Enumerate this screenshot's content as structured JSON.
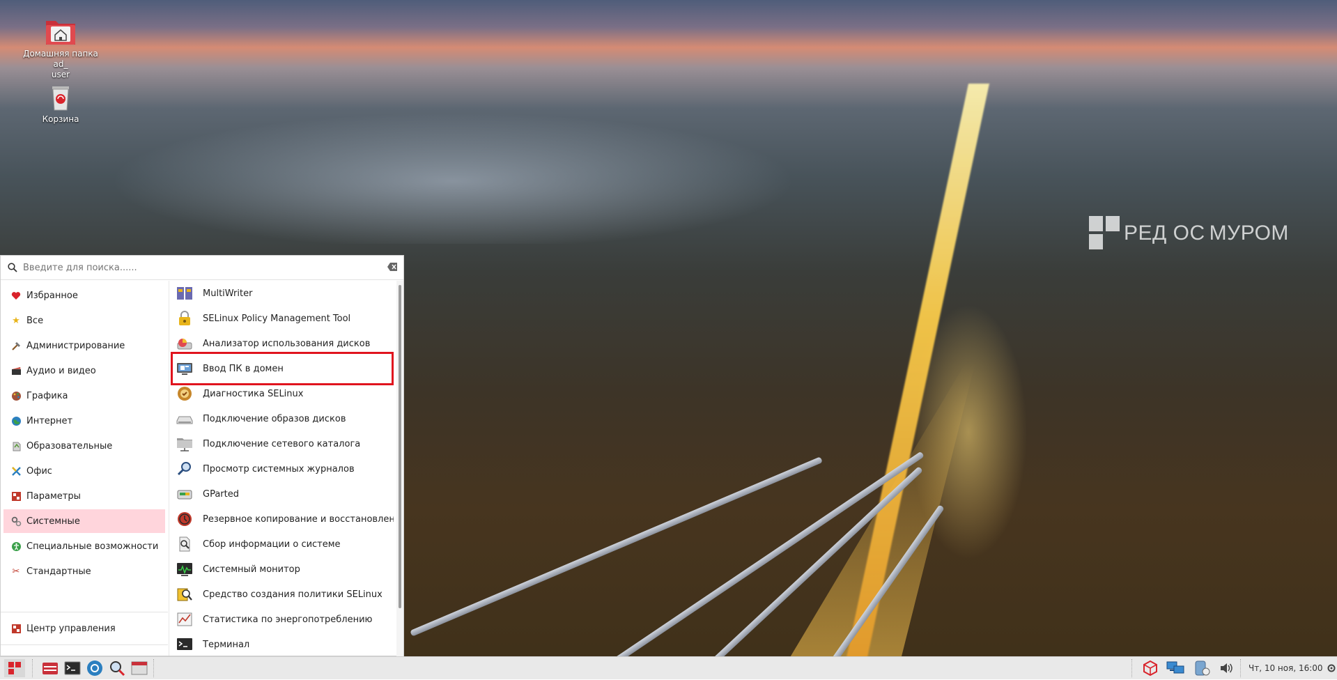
{
  "desktop": {
    "icons": [
      {
        "label": "Домашняя папка ad_\nuser",
        "icon": "home-folder-icon"
      },
      {
        "label": "Корзина",
        "icon": "trash-icon"
      }
    ],
    "watermark": {
      "brand": "РЕД ОС",
      "city": "МУРОМ"
    }
  },
  "menu": {
    "search": {
      "placeholder": "Введите для поиска......"
    },
    "categories": [
      {
        "label": "Избранное",
        "icon": "heart-icon",
        "color": "#d9222a"
      },
      {
        "label": "Все",
        "icon": "star-icon",
        "color": "#e8b41a"
      },
      {
        "label": "Администрирование",
        "icon": "tools-icon",
        "color": "#777777"
      },
      {
        "label": "Аудио и видео",
        "icon": "film-icon",
        "color": "#444444"
      },
      {
        "label": "Графика",
        "icon": "palette-icon",
        "color": "#b04a2a"
      },
      {
        "label": "Интернет",
        "icon": "globe-icon",
        "color": "#2b7fc0"
      },
      {
        "label": "Образовательные",
        "icon": "education-icon",
        "color": "#5a9a3a"
      },
      {
        "label": "Офис",
        "icon": "office-icon",
        "color": "#d89a1a"
      },
      {
        "label": "Параметры",
        "icon": "settings-icon",
        "color": "#c0392b"
      },
      {
        "label": "Системные",
        "icon": "system-icon",
        "color": "#777777",
        "active": true
      },
      {
        "label": "Специальные возможности",
        "icon": "accessibility-icon",
        "color": "#3aa04a"
      },
      {
        "label": "Стандартные",
        "icon": "scissors-icon",
        "color": "#c0392b"
      }
    ],
    "control_center": {
      "label": "Центр управления",
      "icon": "control-center-icon"
    },
    "bottom_buttons": [
      "logout-icon",
      "lock-icon",
      "power-icon"
    ],
    "apps": [
      {
        "label": "MultiWriter",
        "icon": "multiwriter-icon"
      },
      {
        "label": "SELinux Policy Management Tool",
        "icon": "selinux-lock-icon"
      },
      {
        "label": "Анализатор использования дисков",
        "icon": "disk-usage-icon"
      },
      {
        "label": "Ввод ПК в домен",
        "icon": "domain-join-icon",
        "highlighted": true
      },
      {
        "label": "Диагностика SELinux",
        "icon": "selinux-diagnostics-icon"
      },
      {
        "label": "Подключение образов дисков",
        "icon": "disk-image-icon"
      },
      {
        "label": "Подключение сетевого каталога",
        "icon": "network-folder-icon"
      },
      {
        "label": "Просмотр системных журналов",
        "icon": "log-viewer-icon"
      },
      {
        "label": "GParted",
        "icon": "gparted-icon"
      },
      {
        "label": "Резервное копирование и восстановлени...",
        "icon": "backup-icon"
      },
      {
        "label": "Сбор информации о системе",
        "icon": "system-info-icon"
      },
      {
        "label": "Системный монитор",
        "icon": "system-monitor-icon"
      },
      {
        "label": "Средство создания политики SELinux",
        "icon": "selinux-policy-icon"
      },
      {
        "label": "Статистика по энергопотреблению",
        "icon": "power-stats-icon"
      },
      {
        "label": "Терминал",
        "icon": "terminal-icon"
      }
    ]
  },
  "taskbar": {
    "items": [
      "app-menu-icon",
      "file-manager-icon",
      "terminal-icon",
      "browser-icon",
      "search-icon",
      "window-icon"
    ],
    "tray": [
      "package-icon",
      "network-icon",
      "update-icon",
      "volume-icon"
    ],
    "clock": "Чт, 10 ноя, 16:00"
  },
  "colors": {
    "accent": "#ffd5dc",
    "highlight_border": "#e0141e",
    "menu_bg": "#ffffff",
    "taskbar_bg": "#e9e9e9"
  }
}
